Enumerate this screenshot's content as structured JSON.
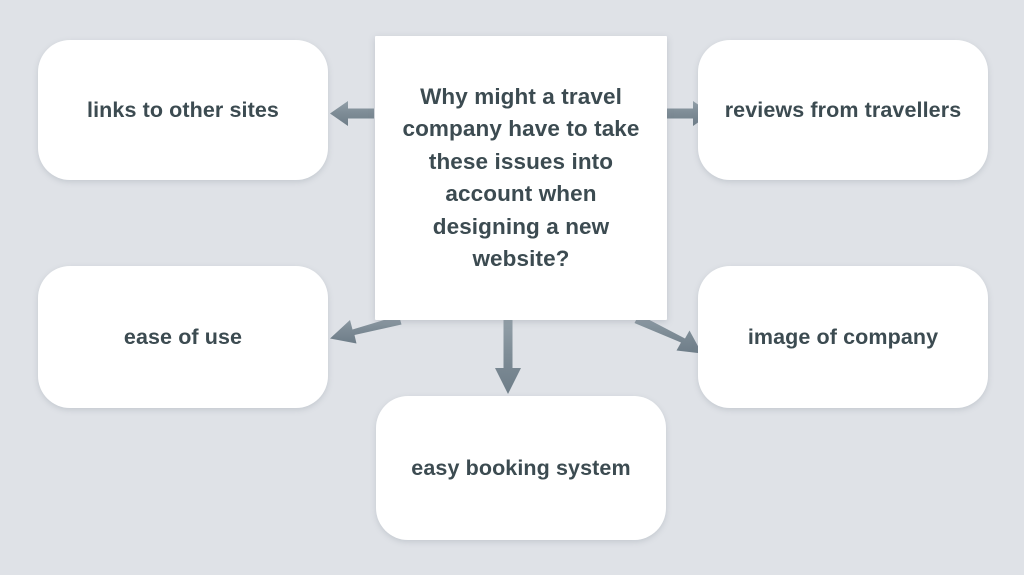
{
  "diagram": {
    "type": "mind-map",
    "title_text": "Why might a travel company have to take these issues into account when designing a new website?",
    "background_color": "#dfe2e7",
    "node_fill_color": "#ffffff",
    "text_color": "#3c4b51",
    "arrow_color": "#7f8d97",
    "central": {
      "id": "central",
      "label": "Why might a travel company have to take these issues into account when designing a new website?"
    },
    "branches": [
      {
        "id": "links",
        "label": "links to other sites",
        "direction": "left",
        "arrow": "arrow-to-links"
      },
      {
        "id": "reviews",
        "label": "reviews from travellers",
        "direction": "right",
        "arrow": "arrow-to-reviews"
      },
      {
        "id": "ease",
        "label": "ease of use",
        "direction": "down-left",
        "arrow": "arrow-to-ease"
      },
      {
        "id": "image",
        "label": "image of company",
        "direction": "down-right",
        "arrow": "arrow-to-image"
      },
      {
        "id": "booking",
        "label": "easy booking system",
        "direction": "down",
        "arrow": "arrow-to-booking"
      }
    ]
  }
}
